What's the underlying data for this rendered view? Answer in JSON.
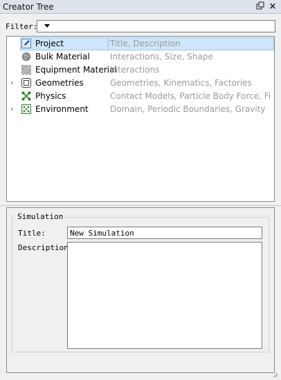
{
  "window": {
    "title": "Creator Tree"
  },
  "filter": {
    "label": "Filter:",
    "value": ""
  },
  "tree": {
    "items": [
      {
        "label": "Project",
        "desc": "Title, Description",
        "icon": "pencil-icon",
        "expandable": false,
        "selected": true
      },
      {
        "label": "Bulk Material",
        "desc": "Interactions, Size, Shape",
        "icon": "bulk-material-icon",
        "expandable": false,
        "selected": false
      },
      {
        "label": "Equipment Material",
        "desc": "Interactions",
        "icon": "equipment-material-icon",
        "expandable": false,
        "selected": false
      },
      {
        "label": "Geometries",
        "desc": "Geometries, Kinematics, Factories",
        "icon": "geometries-icon",
        "expandable": true,
        "selected": false
      },
      {
        "label": "Physics",
        "desc": "Contact Models, Particle Body Force, Field ...",
        "icon": "physics-icon",
        "expandable": false,
        "selected": false
      },
      {
        "label": "Environment",
        "desc": "Domain, Periodic Boundaries, Gravity",
        "icon": "environment-icon",
        "expandable": true,
        "selected": false
      }
    ],
    "expander_glyph": "›"
  },
  "simulation": {
    "group_title": "Simulation",
    "title_label": "Title:",
    "title_value": "New Simulation",
    "description_label": "Description:",
    "description_value": ""
  },
  "colors": {
    "selection": "#cde6fb",
    "accent": "#2b6cb0",
    "physics": "#3a9a3a"
  }
}
